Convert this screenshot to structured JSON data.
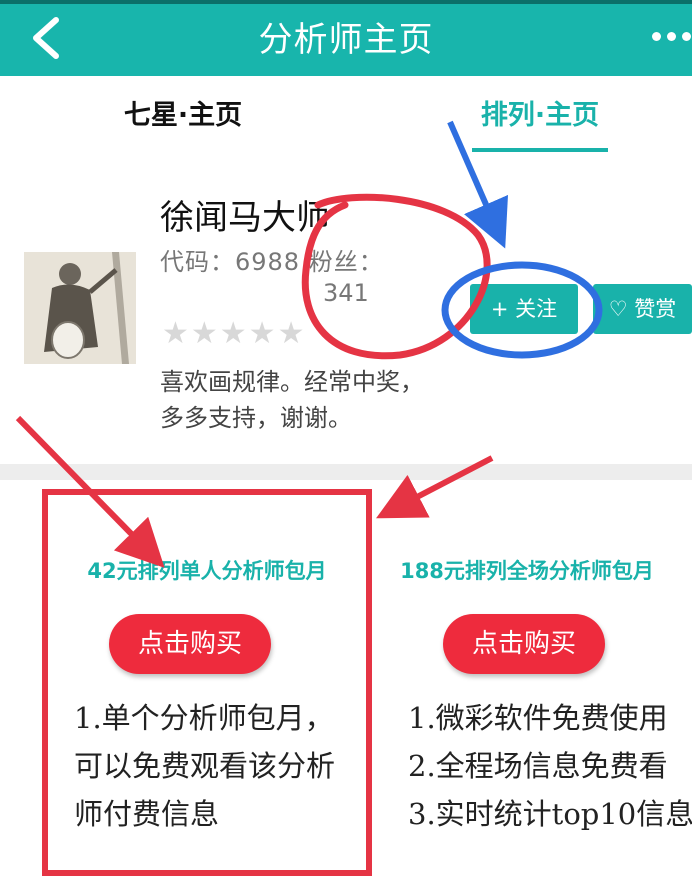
{
  "header": {
    "title": "分析师主页"
  },
  "tabs": [
    {
      "label": "七星·主页"
    },
    {
      "label": "排列·主页"
    }
  ],
  "profile": {
    "name": "徐闻马大师",
    "code_label": "代码：",
    "code": "6988",
    "fans_label": "粉丝：",
    "fans": "341",
    "stars": "★★★★★",
    "bio": "喜欢画规律。经常中奖，多多支持，谢谢。"
  },
  "actions": {
    "follow": "+ 关注",
    "tip": "♡ 赞赏"
  },
  "plans": [
    {
      "title": "42元排列单人分析师包月",
      "buy": "点击购买",
      "features": [
        "1.单个分析师包月，",
        "可以免费观看该分析",
        "师付费信息"
      ]
    },
    {
      "title": "188元排列全场分析师包月",
      "buy": "点击购买",
      "features": [
        "1.微彩软件免费使用",
        "2.全程场信息免费看",
        "3.实时统计top10信息"
      ]
    }
  ],
  "colors": {
    "teal": "#18b5ac",
    "red_button": "#ee2b3d",
    "annotation_red": "#e53444",
    "annotation_blue": "#2f6fe0"
  }
}
